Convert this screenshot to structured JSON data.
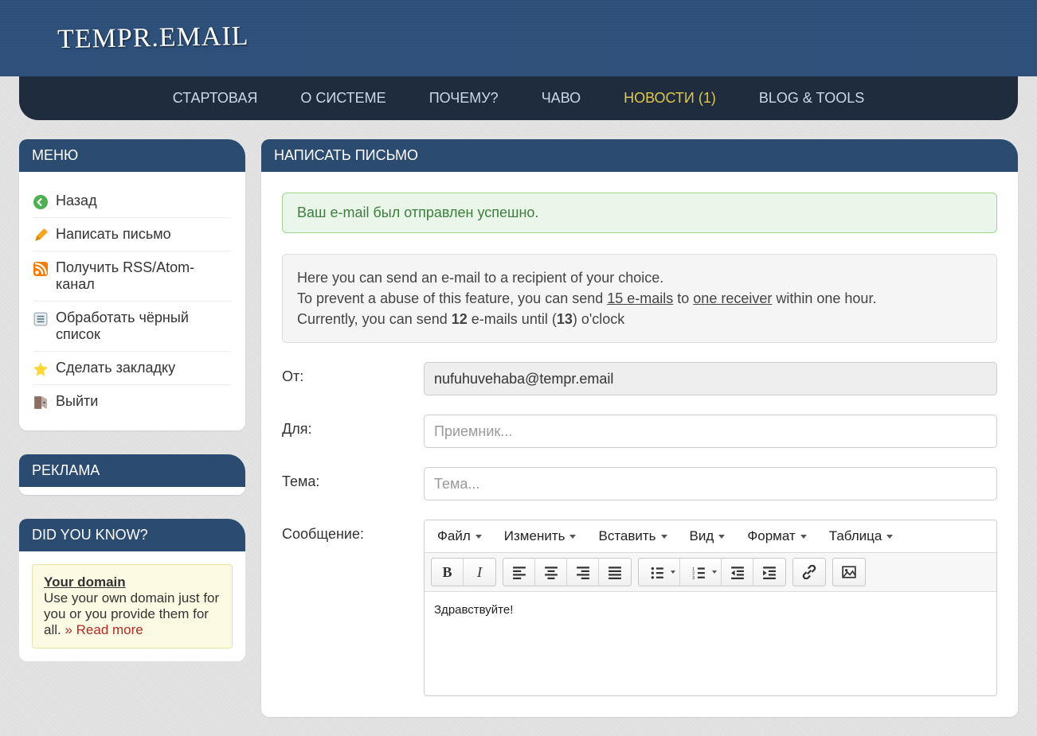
{
  "brand": "TEMPR.EMAIL",
  "nav": [
    {
      "label": "СТАРТОВАЯ",
      "active": false
    },
    {
      "label": "О СИСТЕМЕ",
      "active": false
    },
    {
      "label": "ПОЧЕМУ?",
      "active": false
    },
    {
      "label": "ЧАВО",
      "active": false
    },
    {
      "label": "НОВОСТИ (1)",
      "active": true
    },
    {
      "label": "BLOG & TOOLS",
      "active": false
    }
  ],
  "sidebar": {
    "menu_title": "МЕНЮ",
    "items": [
      {
        "label": "Назад",
        "icon": "back-arrow-icon"
      },
      {
        "label": "Написать письмо",
        "icon": "pencil-icon"
      },
      {
        "label": "Получить RSS/Atom-канал",
        "icon": "rss-icon"
      },
      {
        "label": "Обработать чёрный список",
        "icon": "list-icon"
      },
      {
        "label": "Сделать закладку",
        "icon": "star-icon"
      },
      {
        "label": "Выйти",
        "icon": "exit-icon"
      }
    ],
    "ads_title": "РЕКЛАМА",
    "didyouknow_title": "DID YOU KNOW?",
    "tip": {
      "title": "Your domain",
      "body": "Use your own domain just for you or you provide them for all. ",
      "read_more": "» Read more"
    }
  },
  "main": {
    "panel_title": "НАПИСАТЬ ПИСЬМО",
    "success_message": "Ваш e-mail был отправлен успешно.",
    "info": {
      "line1": "Here you can send an e-mail to a recipient of your choice.",
      "line2_pre": "To prevent a abuse of this feature, you can send ",
      "line2_limit": "15 e-mails",
      "line2_mid": " to ",
      "line2_receiver": "one receiver",
      "line2_post": " within one hour.",
      "line3_pre": "Currently, you can send ",
      "line3_count": "12",
      "line3_mid": " e-mails until (",
      "line3_until": "13",
      "line3_post": ") o'clock"
    },
    "form": {
      "from_label": "От:",
      "from_value": "nufuhuvehaba@tempr.email",
      "to_label": "Для:",
      "to_placeholder": "Приемник...",
      "subject_label": "Тема:",
      "subject_placeholder": "Тема...",
      "message_label": "Сообщение:"
    },
    "editor": {
      "menus": [
        "Файл",
        "Изменить",
        "Вставить",
        "Вид",
        "Формат",
        "Таблица"
      ],
      "content": "Здравствуйте!",
      "toolbar": {
        "bold": "B",
        "italic": "I"
      }
    }
  }
}
